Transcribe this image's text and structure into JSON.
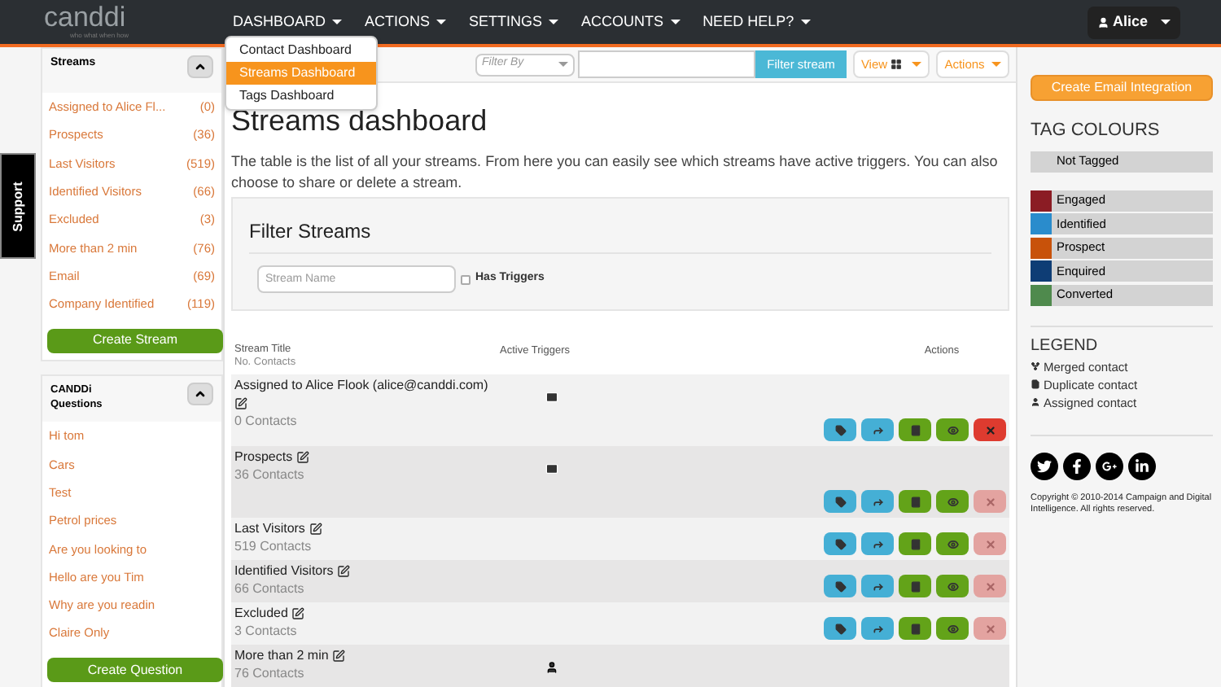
{
  "logo": {
    "name": "canddi",
    "tagline": "who what when how"
  },
  "nav": [
    "DASHBOARD",
    "ACTIONS",
    "SETTINGS",
    "ACCOUNTS",
    "NEED HELP?"
  ],
  "user": {
    "name": "Alice"
  },
  "dropdown": [
    {
      "label": "Contact Dashboard",
      "selected": false
    },
    {
      "label": "Streams Dashboard",
      "selected": true
    },
    {
      "label": "Tags Dashboard",
      "selected": false
    }
  ],
  "support_tab": "Support",
  "streams_panel": {
    "title": "Streams",
    "items": [
      {
        "label": "Assigned to Alice Fl...",
        "count": "(0)"
      },
      {
        "label": "Prospects",
        "count": "(36)"
      },
      {
        "label": "Last Visitors",
        "count": "(519)"
      },
      {
        "label": "Identified Visitors",
        "count": "(66)"
      },
      {
        "label": "Excluded",
        "count": "(3)"
      },
      {
        "label": "More than 2 min",
        "count": "(76)"
      },
      {
        "label": "Email",
        "count": "(69)"
      },
      {
        "label": "Company Identified",
        "count": "(119)"
      }
    ],
    "button": "Create Stream"
  },
  "questions_panel": {
    "title": "CANDDi Questions",
    "items": [
      "Hi tom",
      "Cars",
      "Test",
      "Petrol prices",
      "Are you looking to",
      "Hello are you Tim",
      "Why are you readin",
      "Claire Only"
    ],
    "button": "Create Question"
  },
  "toolbar": {
    "filter_by": "Filter By",
    "filter_button": "Filter stream",
    "view": "View",
    "actions": "Actions"
  },
  "page_title": "Streams dashboard",
  "description": "The table is the list of all your streams. From here you can easily see which streams have active triggers. You can also choose to share or delete a stream.",
  "filter": {
    "title": "Filter Streams",
    "name_placeholder": "Stream Name",
    "has_triggers": {
      "label": "Has Triggers",
      "checked": false
    }
  },
  "table": {
    "columns": {
      "title": "Stream Title",
      "subtitle": "No. Contacts",
      "triggers": "Active Triggers",
      "actions": "Actions"
    },
    "rows": [
      {
        "title": "Assigned to Alice Flook (alice@canddi.com)",
        "contacts": "0 Contacts",
        "kind": "mail",
        "delete_enabled": true
      },
      {
        "title": "Prospects",
        "contacts": "36 Contacts",
        "kind": "mail",
        "delete_enabled": false
      },
      {
        "title": "Last Visitors",
        "contacts": "519 Contacts",
        "kind": "plain",
        "delete_enabled": false
      },
      {
        "title": "Identified Visitors",
        "contacts": "66 Contacts",
        "kind": "plain",
        "delete_enabled": false
      },
      {
        "title": "Excluded",
        "contacts": "3 Contacts",
        "kind": "plain",
        "delete_enabled": false
      },
      {
        "title": "More than 2 min",
        "contacts": "76 Contacts",
        "kind": "user"
      }
    ]
  },
  "right": {
    "button": "Create Email Integration",
    "tag_title": "TAG COLOURS",
    "not_tagged": "Not Tagged",
    "tags": [
      {
        "label": "Engaged",
        "color": "#8b1c24"
      },
      {
        "label": "Identified",
        "color": "#2a8ccc"
      },
      {
        "label": "Prospect",
        "color": "#c8520a"
      },
      {
        "label": "Enquired",
        "color": "#0e3d75"
      },
      {
        "label": "Converted",
        "color": "#4f8a4d"
      }
    ],
    "legend_title": "LEGEND",
    "legend": [
      {
        "kind": "merged",
        "label": "Merged contact"
      },
      {
        "kind": "duplicate",
        "label": "Duplicate contact"
      },
      {
        "kind": "assigned",
        "label": "Assigned contact"
      }
    ],
    "social": [
      {
        "kind": "twitter"
      },
      {
        "kind": "facebook"
      },
      {
        "kind": "googleplus"
      },
      {
        "kind": "linkedin"
      }
    ],
    "copyright": "Copyright © 2010-2014 Campaign and Digital Intelligence. All rights reserved."
  }
}
